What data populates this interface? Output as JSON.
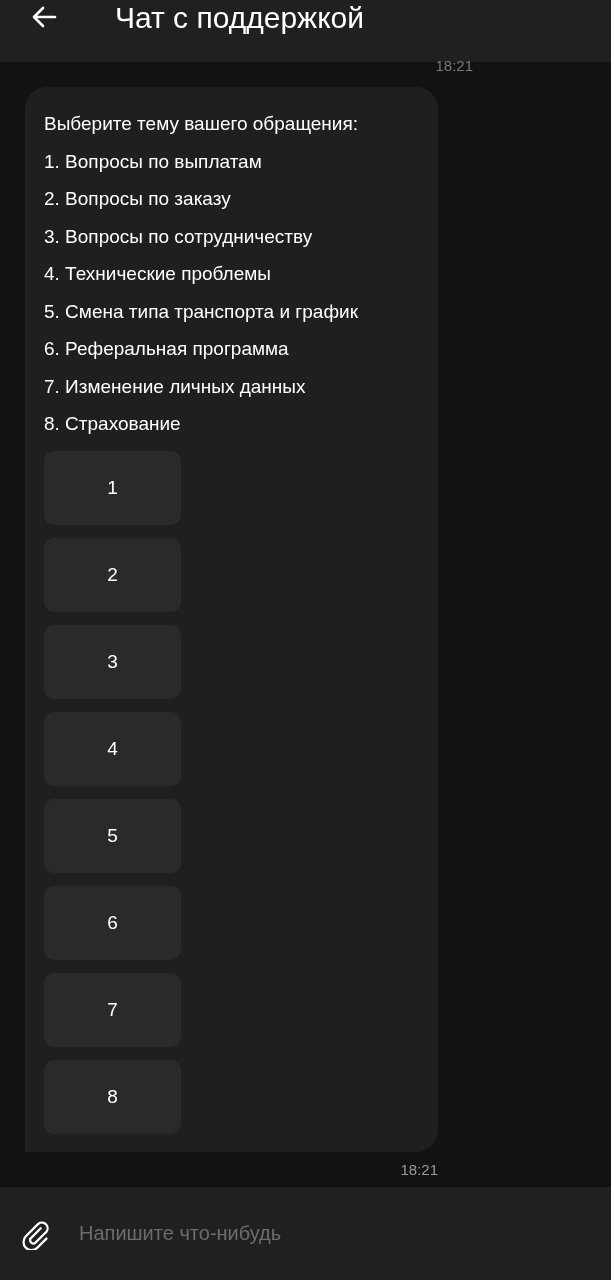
{
  "header": {
    "title": "Чат с поддержкой"
  },
  "messages": [
    {
      "time": "18:21",
      "lines": [
        "Выберите тему вашего обращения:",
        "1. Вопросы по выплатам",
        "2. Вопросы по заказу",
        "3. Вопросы по сотрудничеству",
        "4. Технические проблемы",
        "5. Смена типа транспорта и график",
        "6. Реферальная программа",
        "7. Изменение личных данных",
        "8. Страхование"
      ],
      "buttons": [
        "1",
        "2",
        "3",
        "4",
        "5",
        "6",
        "7",
        "8"
      ],
      "sent_time": "18:21"
    }
  ],
  "composer": {
    "placeholder": "Напишите что-нибудь"
  }
}
